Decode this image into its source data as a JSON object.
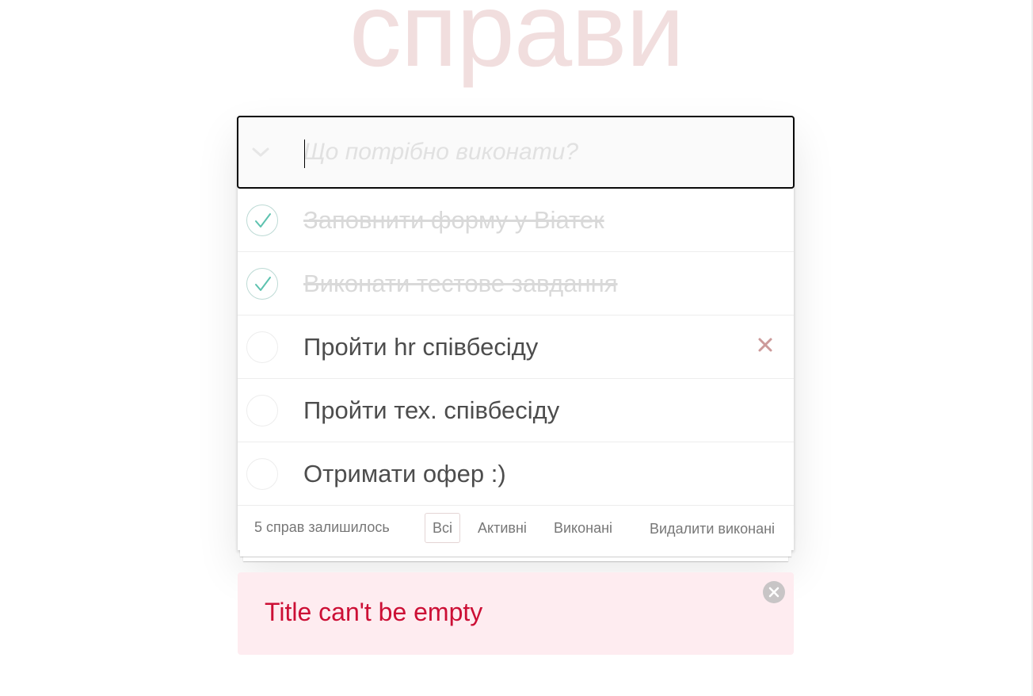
{
  "app": {
    "title": "справи"
  },
  "new_todo": {
    "placeholder": "Що потрібно виконати?",
    "value": ""
  },
  "todos": [
    {
      "title": "Заповнити форму у Віатек",
      "completed": true
    },
    {
      "title": "Виконати тестове завдання",
      "completed": true
    },
    {
      "title": "Пройти hr співбесіду",
      "completed": false
    },
    {
      "title": "Пройти тех. співбесіду",
      "completed": false
    },
    {
      "title": "Отримати офер :)",
      "completed": false
    }
  ],
  "footer": {
    "count_label": "5 справ залишилось",
    "filters": {
      "all": "Всі",
      "active": "Активні",
      "completed": "Виконані"
    },
    "selected_filter": "all",
    "clear_completed": "Видалити виконані"
  },
  "notification": {
    "message": "Title can't be empty"
  },
  "colors": {
    "title": "#f1dede",
    "check": "#5dc2af",
    "destroy": "#cc9a9a",
    "error_bg": "#feecf0",
    "error_text": "#cc0f35"
  },
  "icons": {
    "toggle_all": "chevron-down-icon",
    "completed_toggle": "checkmark-icon",
    "destroy": "close-icon",
    "notification_close": "close-circle-icon"
  }
}
